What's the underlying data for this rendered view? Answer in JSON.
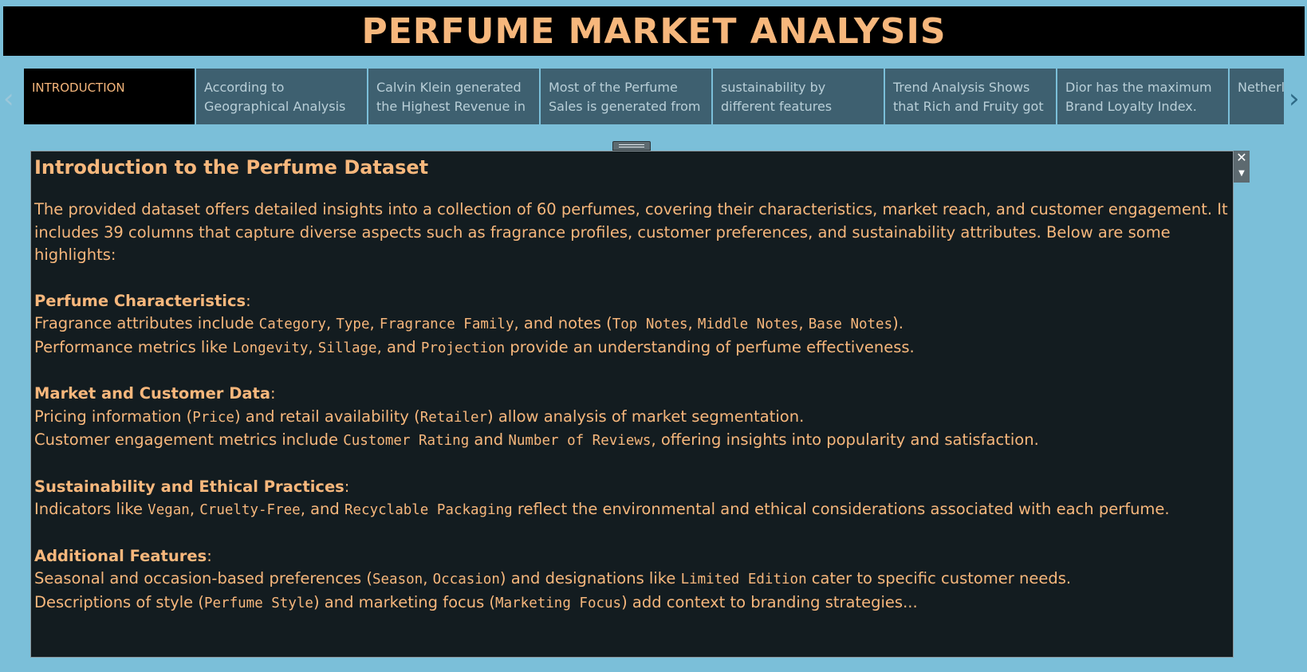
{
  "header": {
    "title": "PERFUME MARKET ANALYSIS"
  },
  "nav": {
    "prev_icon": "chevron-left-icon",
    "next_icon": "chevron-right-icon",
    "tabs": [
      {
        "label": "INTRODUCTION",
        "active": true
      },
      {
        "label": "According to Geographical Analysis"
      },
      {
        "label": "Calvin Klein generated the Highest Revenue in"
      },
      {
        "label": "Most of the Perfume Sales is generated from"
      },
      {
        "label": "sustainability by different features"
      },
      {
        "label": "Trend Analysis Shows that Rich and Fruity got"
      },
      {
        "label": "Dior has the maximum Brand Loyalty Index."
      },
      {
        "label": "Netherlands highest"
      }
    ]
  },
  "panel": {
    "close_icon": "close-icon",
    "menu_icon": "dropdown-arrow-icon",
    "heading": "Introduction to the Perfume Dataset",
    "intro": "The provided dataset offers detailed insights into a collection of 60 perfumes, covering their characteristics, market reach, and customer engagement. It includes 39 columns that capture diverse aspects such as fragrance profiles, customer preferences, and sustainability attributes. Below are some highlights:",
    "sections": [
      {
        "title": "Perfume Characteristics",
        "lines": [
          {
            "t1": "Fragrance attributes include ",
            "c1": "Category",
            "t2": ", ",
            "c2": "Type",
            "t3": ", ",
            "c3": "Fragrance Family",
            "t4": ", and notes (",
            "c4": "Top Notes",
            "t5": ", ",
            "c5": "Middle Notes",
            "t6": ", ",
            "c6": "Base Notes",
            "t7": ")."
          },
          {
            "t1": "Performance metrics like ",
            "c1": "Longevity",
            "t2": ", ",
            "c2": "Sillage",
            "t3": ", and ",
            "c3": "Projection",
            "t4": " provide an understanding of perfume effectiveness."
          }
        ]
      },
      {
        "title": "Market and Customer Data",
        "lines": [
          {
            "t1": "Pricing information (",
            "c1": "Price",
            "t2": ") and retail availability (",
            "c2": "Retailer",
            "t3": ") allow analysis of market segmentation."
          },
          {
            "t1": "Customer engagement metrics include ",
            "c1": "Customer Rating",
            "t2": " and ",
            "c2": "Number of Reviews",
            "t3": ", offering insights into popularity and satisfaction."
          }
        ]
      },
      {
        "title": "Sustainability and Ethical Practices",
        "lines": [
          {
            "t1": "Indicators like ",
            "c1": "Vegan",
            "t2": ", ",
            "c2": "Cruelty-Free",
            "t3": ", and ",
            "c3": "Recyclable Packaging",
            "t4": " reflect the environmental and ethical considerations associated with each perfume."
          }
        ]
      },
      {
        "title": "Additional Features",
        "lines": [
          {
            "t1": "Seasonal and occasion-based preferences (",
            "c1": "Season",
            "t2": ", ",
            "c2": "Occasion",
            "t3": ") and designations like ",
            "c3": "Limited Edition",
            "t4": " cater to specific customer needs."
          },
          {
            "t1": "Descriptions of style (",
            "c1": "Perfume Style",
            "t2": ") and marketing focus (",
            "c2": "Marketing Focus",
            "t3": ") add context to branding strategies..."
          }
        ]
      }
    ],
    "colon": ":"
  },
  "colors": {
    "background": "#7bbfd9",
    "accent": "#f7b77c",
    "panel_bg": "#131c20",
    "tab_bg": "#3e6070",
    "tab_active_bg": "#000000"
  }
}
